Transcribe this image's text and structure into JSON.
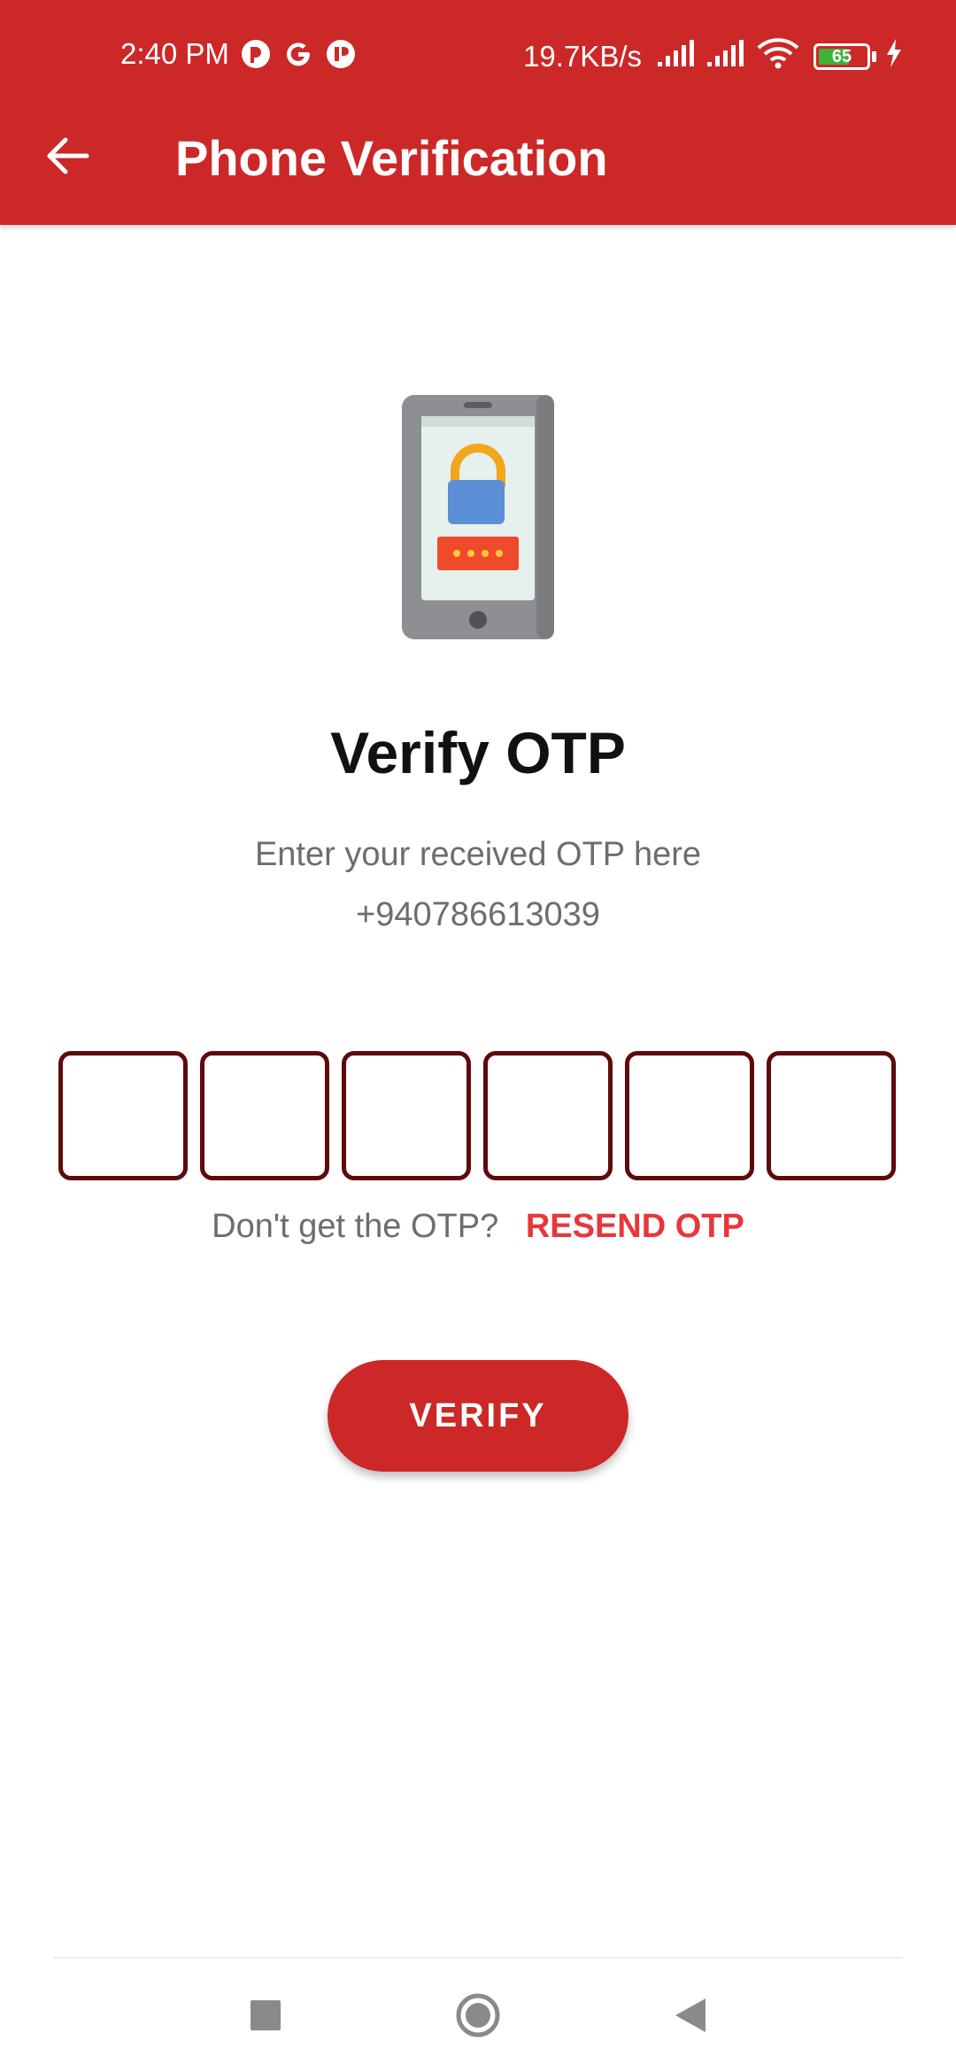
{
  "status_bar": {
    "time": "2:40 PM",
    "net_speed": "19.7KB/s",
    "battery_level": "65",
    "battery_percent": 65
  },
  "app_bar": {
    "title": "Phone Verification",
    "back_icon": "arrow-back-icon"
  },
  "illustration_icon": "phone-lock-icon",
  "verify": {
    "heading": "Verify OTP",
    "instruction": "Enter your received OTP here",
    "phone_number": "+940786613039"
  },
  "otp": {
    "digits": [
      "",
      "",
      "",
      "",
      "",
      ""
    ]
  },
  "resend": {
    "question": "Don't get the OTP?",
    "link_label": "RESEND OTP"
  },
  "verify_button": {
    "label": "VERIFY"
  },
  "colors": {
    "primary": "#cc2828",
    "otp_border": "#5e0a0a",
    "resend_link": "#e8373a"
  },
  "nav_bar": {
    "items": [
      "recents-square-icon",
      "home-circle-icon",
      "back-triangle-icon"
    ]
  }
}
